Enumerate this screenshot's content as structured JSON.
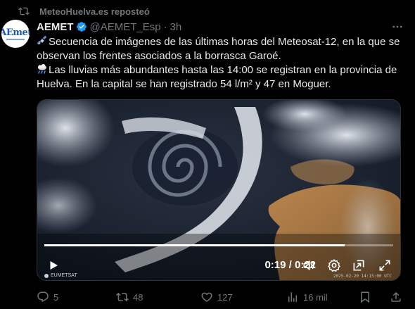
{
  "repost": {
    "label": "MeteoHuelva.es reposteó"
  },
  "author": {
    "name": "AEMET",
    "handle": "@AEMET_Esp",
    "separator": "·",
    "time": "3h",
    "avatar_logo": "AEmet",
    "verified_color": "#1d9bf0"
  },
  "tweet": {
    "line1_emoji": "satellite-emoji",
    "line1": "Secuencia de imágenes de las últimas horas del Meteosat-12, en la que se observan los frentes asociados a la borrasca Garoé.",
    "line2_emoji": "rain-cloud-emoji",
    "line2": "Las lluvias más abundantes hasta las 14:00 se registran en la provincia de Huelva. En la capital se han registrado 54 l/m² y 47 en Moguer."
  },
  "video": {
    "current_time": "0:19",
    "duration": "0:22",
    "time_display": "0:19 / 0:22",
    "progress": 0.86,
    "watermark": "EUMETSAT",
    "timestamp": "2025-02-20 14:15:00 UTC",
    "controls": [
      "play-icon",
      "volume-icon",
      "settings-icon",
      "pip-icon",
      "fullscreen-icon"
    ]
  },
  "actions": {
    "replies": "5",
    "reposts": "48",
    "likes": "127",
    "views": "16 mil"
  },
  "colors": {
    "background": "#000000",
    "text": "#e7e9ea",
    "muted": "#71767b",
    "accent": "#1d9bf0"
  }
}
